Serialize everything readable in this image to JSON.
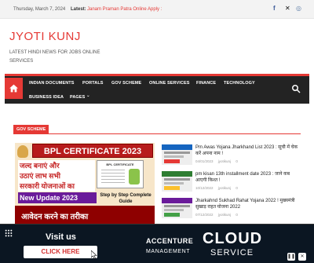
{
  "topbar": {
    "date": "Thursday, March 7, 2024",
    "latest_label": "Latest:",
    "latest_link": "Janam Praman Patra Online Apply :"
  },
  "site": {
    "title": "JYOTI KUNJ",
    "description": "LATEST HINDI NEWS FOR JOBS ONLINE SERVICES"
  },
  "nav": {
    "items": [
      "INDIAN DOCUMENTS",
      "PORTALS",
      "GOV SCHEME",
      "ONLINE SERVICES",
      "FINANCE",
      "TECHNOLOGY",
      "BUSINESS IDEA",
      "PAGES"
    ],
    "pages_caret": "⌄"
  },
  "section": {
    "label": "GOV SCHEME"
  },
  "featured": {
    "headline": "BPL CERTIFICATE 2023",
    "line1": "जल्द बनाएं और",
    "line2": "उठाएं लाभ सभी",
    "line3": "सरकारी योजनाओं का",
    "update": "New Update 2023",
    "cert_label": "BPL CERTIFICATE",
    "guide": "Step by Step Complete Guide",
    "bottom": "आवेदन करने का तरीका"
  },
  "posts": [
    {
      "title": "Pm Awas Yojana Jharkhand List 2023 : सूची में चेक करें अपना नाम !",
      "date": "04/01/2023",
      "author": "jyotikunj",
      "comments": "0",
      "thumb_color": "#1565c0",
      "thumb_btn": "#e53935"
    },
    {
      "title": "pm kisan 13th installment date 2023 : जाने कब आएगी किश्त !",
      "date": "10/12/2022",
      "author": "jyotikunj",
      "comments": "0",
      "thumb_color": "#2e7d32",
      "thumb_btn": "#fbc02d"
    },
    {
      "title": "Jharkahnd Sukhad Rahat Yojana 2022 ! मुख्यमंत्री सुखाड़ राहत योजना 2022",
      "date": "07/12/2022",
      "author": "jyotikunj",
      "comments": "0",
      "thumb_color": "#6a1b9a",
      "thumb_btn": "#43a047"
    }
  ],
  "ad": {
    "visit": "Visit us",
    "click": "CLICK HERE",
    "brand": "ACCENTURE",
    "cloud": "CLOUD",
    "management": "MANAGEMENT",
    "service": "SERVICE"
  },
  "colors": {
    "accent": "#e53935",
    "nav_bg": "#232323"
  }
}
